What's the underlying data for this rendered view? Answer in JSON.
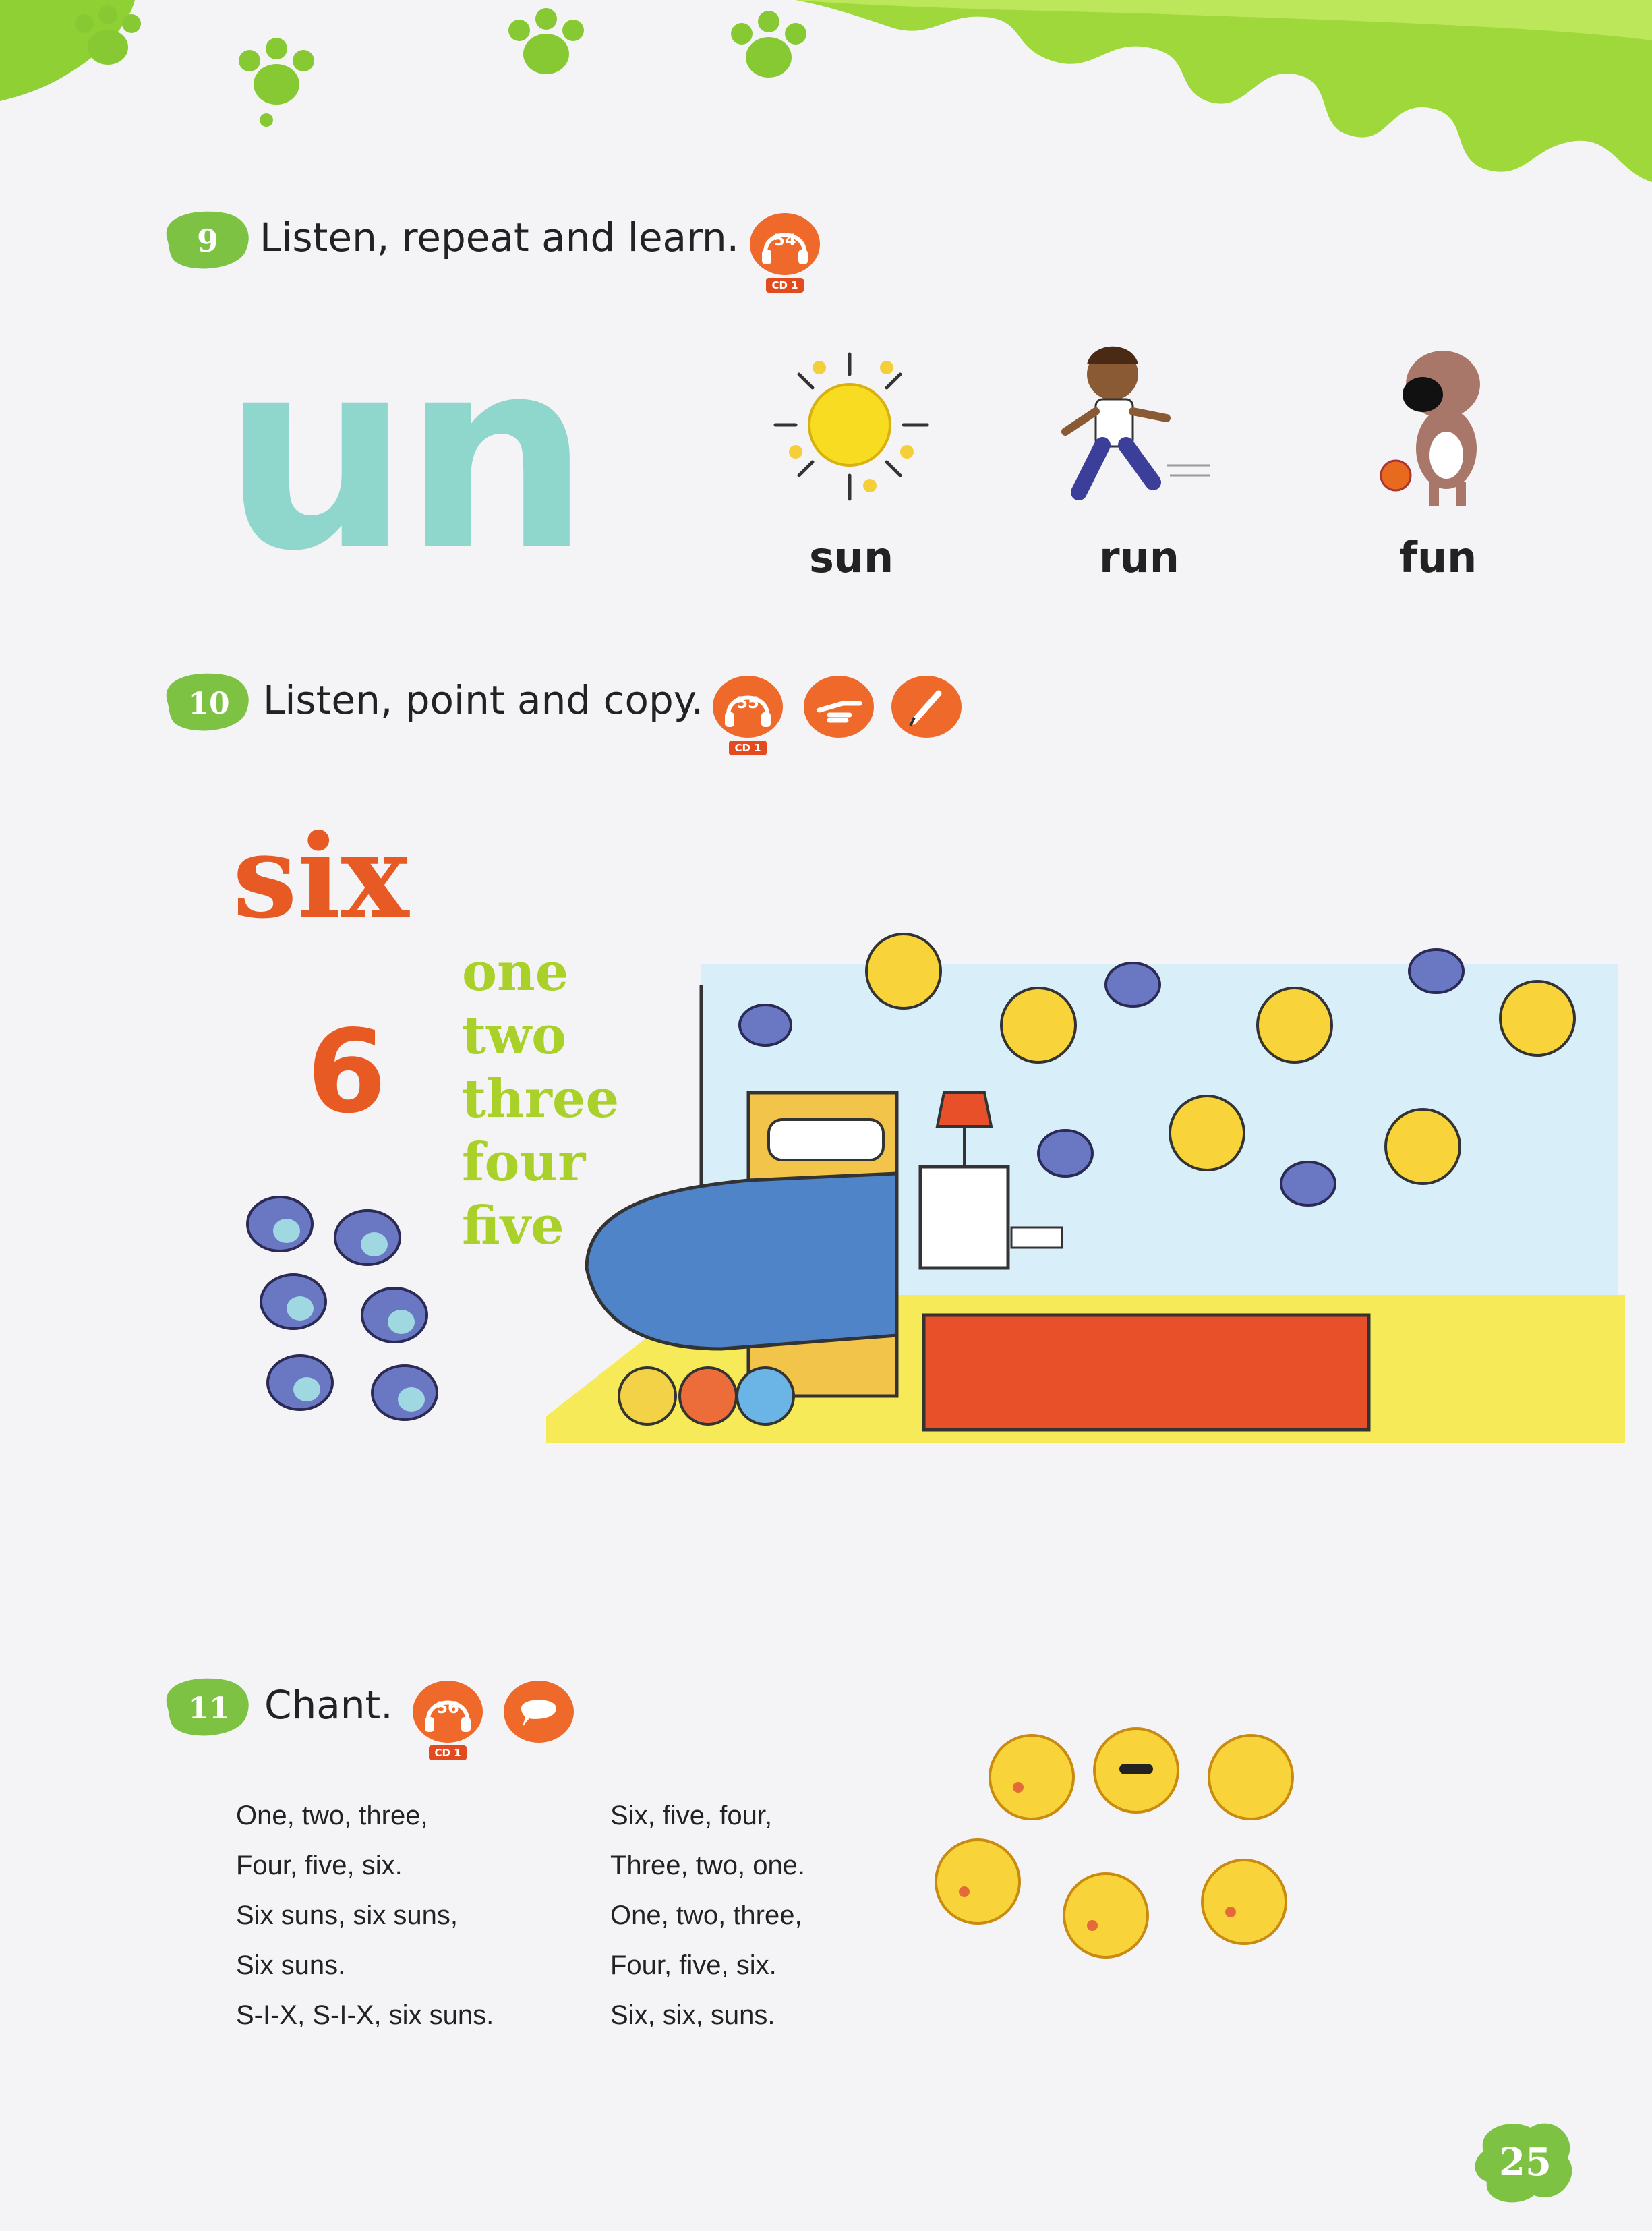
{
  "exercise9": {
    "number": "9",
    "instruction": "Listen, repeat and learn.",
    "track": "54",
    "cd": "CD 1"
  },
  "phonics": {
    "pattern": "un",
    "words": [
      "sun",
      "run",
      "fun"
    ]
  },
  "exercise10": {
    "number": "10",
    "instruction": "Listen, point and copy.",
    "track": "55",
    "cd": "CD 1"
  },
  "number_focus": {
    "word": "six",
    "digit": "6",
    "count_words": [
      "one",
      "two",
      "three",
      "four",
      "five"
    ]
  },
  "exercise11": {
    "number": "11",
    "instruction": "Chant.",
    "track": "56",
    "cd": "CD 1"
  },
  "chant": {
    "left": [
      "One, two, three,",
      "Four, five, six.",
      "Six suns, six suns,",
      "Six suns.",
      "S-I-X, S-I-X, six suns."
    ],
    "right": [
      "Six, five, four,",
      "Three, two, one.",
      "One, two, three,",
      "Four, five, six.",
      "Six, six, suns."
    ]
  },
  "page_number": "25",
  "colors": {
    "accent_green": "#7dc242",
    "orange": "#e85a24",
    "teal": "#8fd6cc",
    "lime": "#a9d12a"
  },
  "icons": [
    "headphones-icon",
    "pointing-hand-icon",
    "pencil-icon",
    "speech-bubble-icon"
  ]
}
